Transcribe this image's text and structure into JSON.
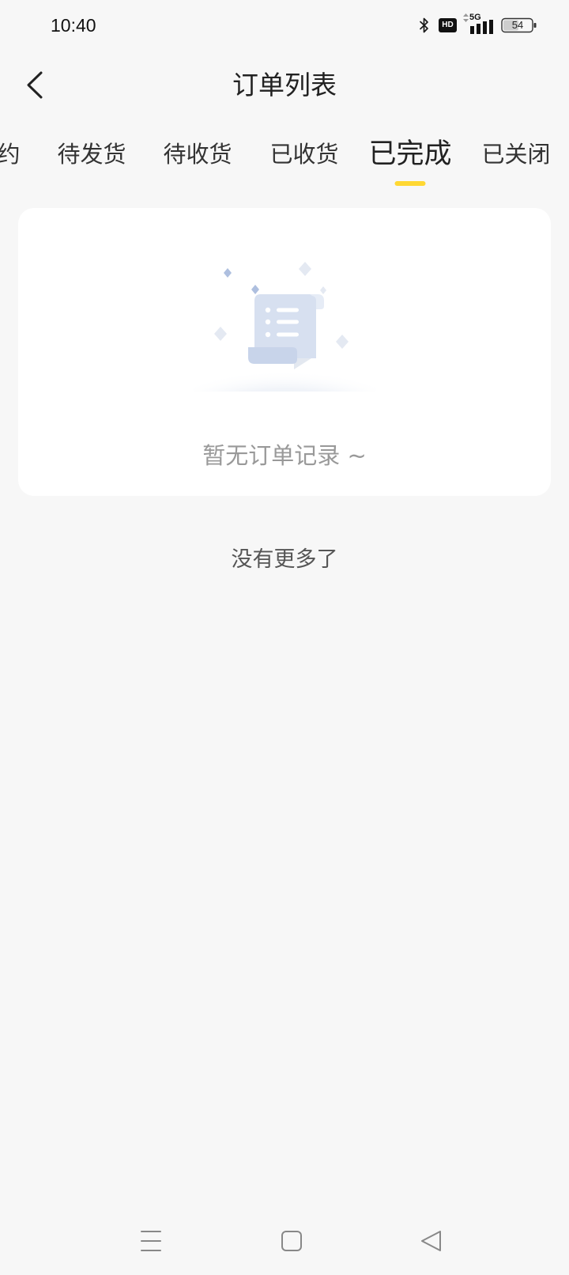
{
  "status_bar": {
    "time": "10:40",
    "hd_label": "HD",
    "network_label": "5G",
    "battery_level": "54",
    "icons": [
      "bluetooth-icon",
      "hd-icon",
      "data-activity-icon",
      "signal-icon",
      "battery-icon"
    ]
  },
  "header": {
    "title": "订单列表",
    "back_icon": "chevron-left-icon"
  },
  "tabs": [
    {
      "label": "约",
      "selected": false
    },
    {
      "label": "待发货",
      "selected": false
    },
    {
      "label": "待收货",
      "selected": false
    },
    {
      "label": "已收货",
      "selected": false
    },
    {
      "label": "已完成",
      "selected": true
    },
    {
      "label": "已关闭",
      "selected": false
    }
  ],
  "empty_state": {
    "illustration_icon": "empty-order-scroll-icon",
    "message": "暂无订单记录 ~"
  },
  "list_footer": {
    "text": "没有更多了"
  },
  "nav_bar": {
    "icons": [
      "menu-icon",
      "home-square-icon",
      "back-triangle-icon"
    ]
  },
  "colors": {
    "background": "#f7f7f7",
    "accent": "#ffd833",
    "card": "#ffffff",
    "text_primary": "#222222",
    "text_muted": "#999999",
    "text_secondary": "#555555"
  }
}
